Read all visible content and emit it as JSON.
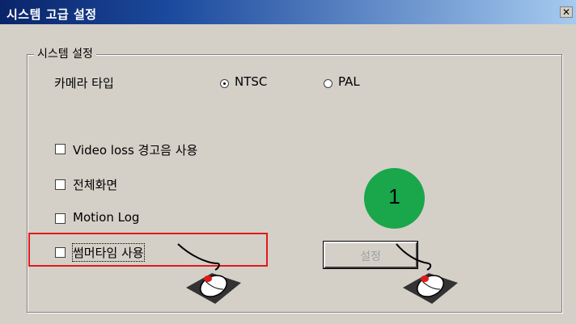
{
  "window": {
    "title": "시스템 고급 설정",
    "close_glyph": "✕"
  },
  "group": {
    "label": "시스템 설정"
  },
  "camera_type": {
    "label": "카메라 타입",
    "options": [
      {
        "label": "NTSC",
        "selected": true
      },
      {
        "label": "PAL",
        "selected": false
      }
    ]
  },
  "options": [
    {
      "label": "Video loss 경고음 사용",
      "checked": false
    },
    {
      "label": "전체화면",
      "checked": false
    },
    {
      "label": "Motion Log",
      "checked": false
    },
    {
      "label": "썸머타임 사용",
      "checked": false
    }
  ],
  "set_button": {
    "label": "설정",
    "enabled": false
  },
  "step_badge": {
    "number": "1",
    "color": "#1aa64a"
  },
  "colors": {
    "highlight": "#e01a1a",
    "dialog_bg": "#d4d0c8",
    "title_bg": "#0a246a"
  },
  "icons": [
    "close-icon",
    "mouse-click-icon"
  ]
}
